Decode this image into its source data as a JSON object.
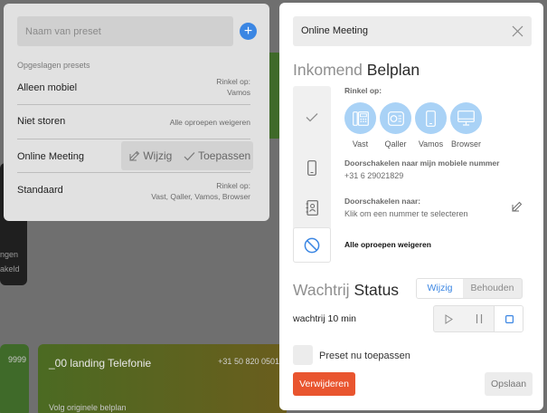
{
  "background": {
    "dark_card_line1": "ngen",
    "dark_card_line2": "akeld",
    "green_left_text": "9999",
    "landing_card": {
      "title": "_00 landing Telefonie",
      "number": "+31 50 820 0501",
      "footer": "Volg originele belplan"
    }
  },
  "presets": {
    "input_placeholder": "Naam van preset",
    "add_icon": "plus-icon",
    "saved_label": "Opgeslagen presets",
    "items": [
      {
        "name": "Alleen mobiel",
        "desc_line1": "Rinkel op:",
        "desc_line2": "Vamos"
      },
      {
        "name": "Niet storen",
        "desc_line1": "Alle oproepen weigeren",
        "desc_line2": ""
      },
      {
        "name": "Online Meeting",
        "edit_label": "Wijzig",
        "apply_label": "Toepassen"
      },
      {
        "name": "Standaard",
        "desc_line1": "Rinkel op:",
        "desc_line2": "Vast, Qaller, Vamos, Browser"
      }
    ]
  },
  "modal": {
    "title": "Online Meeting",
    "incoming": {
      "light": "Inkomend",
      "dark": "Belplan"
    },
    "ring_on_label": "Rinkel op:",
    "ring_devices": [
      {
        "label": "Vast",
        "icon": "desk-phone-icon"
      },
      {
        "label": "Qaller",
        "icon": "qaller-app-icon"
      },
      {
        "label": "Vamos",
        "icon": "mobile-icon"
      },
      {
        "label": "Browser",
        "icon": "monitor-icon"
      }
    ],
    "forward_mobile_label": "Doorschakelen naar mijn mobiele nummer",
    "forward_mobile_value": "+31 6 29021829",
    "forward_label": "Doorschakelen naar:",
    "forward_value": "Klik om een nummer te selecteren",
    "reject_label": "Alle oproepen weigeren",
    "queue": {
      "light": "Wachtrij",
      "dark": "Status"
    },
    "toggle": {
      "edit": "Wijzig",
      "keep": "Behouden"
    },
    "queue_text": "wachtrij 10 min",
    "apply_now_label": "Preset nu toepassen",
    "delete_label": "Verwijderen",
    "save_label": "Opslaan",
    "accent_color": "#3b86e3",
    "danger_color": "#e9552f"
  }
}
